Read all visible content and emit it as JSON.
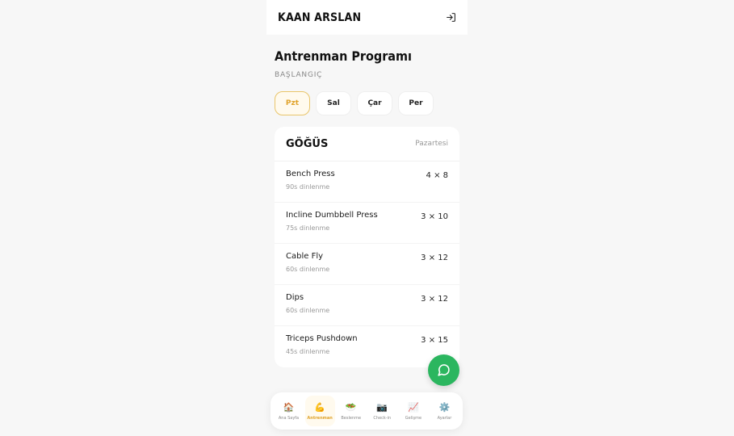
{
  "header": {
    "brand": "KAAN ARSLAN",
    "logout_icon": "logout-icon"
  },
  "program": {
    "title": "Antrenman Programı",
    "level": "BAŞLANGIÇ"
  },
  "days": [
    {
      "label": "Pzt",
      "active": true
    },
    {
      "label": "Sal",
      "active": false
    },
    {
      "label": "Çar",
      "active": false
    },
    {
      "label": "Per",
      "active": false
    }
  ],
  "workout": {
    "muscle_group": "GÖĞÜS",
    "day_name": "Pazartesi",
    "exercises": [
      {
        "name": "Bench Press",
        "rest": "90s dinlenme",
        "sets": "4 × 8"
      },
      {
        "name": "Incline Dumbbell Press",
        "rest": "75s dinlenme",
        "sets": "3 × 10"
      },
      {
        "name": "Cable Fly",
        "rest": "60s dinlenme",
        "sets": "3 × 12"
      },
      {
        "name": "Dips",
        "rest": "60s dinlenme",
        "sets": "3 × 12"
      },
      {
        "name": "Triceps Pushdown",
        "rest": "45s dinlenme",
        "sets": "3 × 15"
      }
    ]
  },
  "chat": {
    "icon": "chat-icon",
    "color": "#2bb65f"
  },
  "nav": {
    "items": [
      {
        "emoji": "🏠",
        "label": "Ana Sayfa",
        "active": false
      },
      {
        "emoji": "💪",
        "label": "Antrenman",
        "active": true
      },
      {
        "emoji": "🥗",
        "label": "Beslenme",
        "active": false
      },
      {
        "emoji": "📷",
        "label": "Check-in",
        "active": false
      },
      {
        "emoji": "📈",
        "label": "Gelişme",
        "active": false
      },
      {
        "emoji": "⚙️",
        "label": "Ayarlar",
        "active": false
      }
    ]
  },
  "colors": {
    "accent": "#e0a32b",
    "accent_bg": "#fffaee",
    "background": "#f7f7f7",
    "fab": "#2bb65f"
  }
}
